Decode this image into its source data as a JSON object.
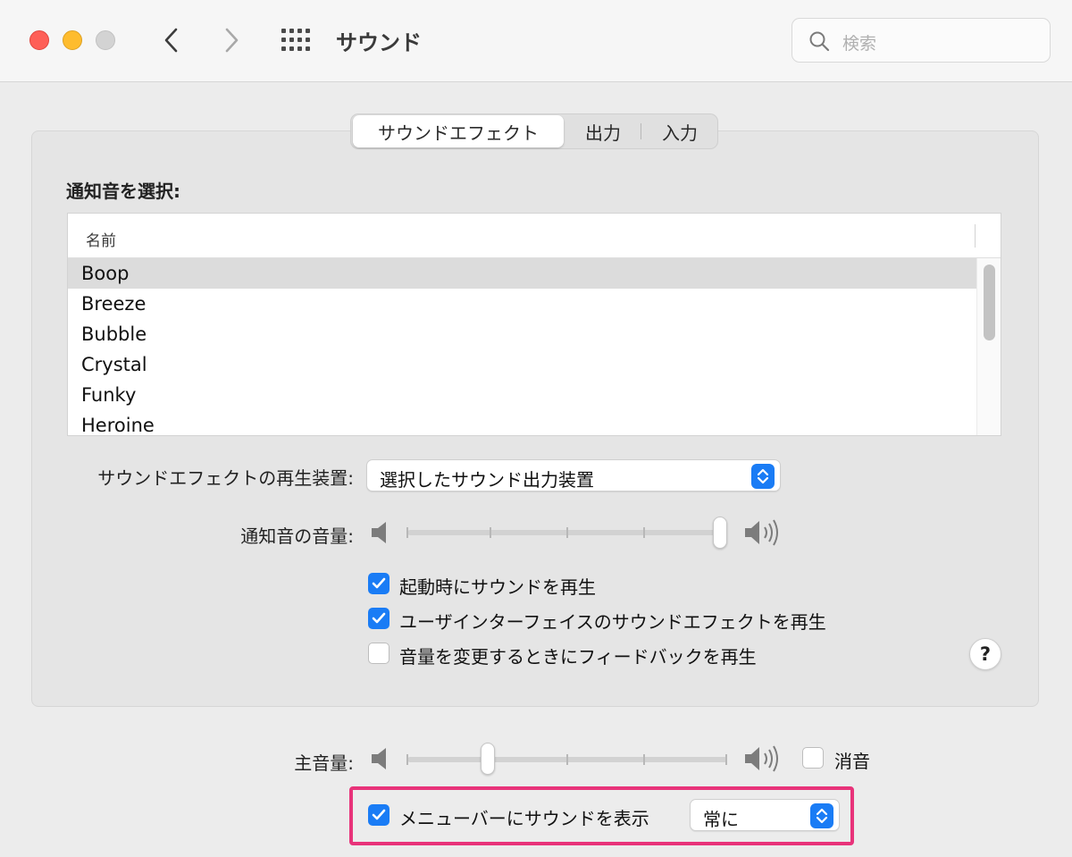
{
  "window": {
    "title": "サウンド",
    "search_placeholder": "検索"
  },
  "tabs": [
    {
      "label": "サウンドエフェクト",
      "selected": true
    },
    {
      "label": "出力",
      "selected": false
    },
    {
      "label": "入力",
      "selected": false
    }
  ],
  "alerts": {
    "section_label": "通知音を選択:",
    "column_header": "名前",
    "sounds": [
      "Boop",
      "Breeze",
      "Bubble",
      "Crystal",
      "Funky",
      "Heroine"
    ],
    "selected": "Boop"
  },
  "playback": {
    "label": "サウンドエフェクトの再生装置:",
    "value": "選択したサウンド出力装置"
  },
  "alert_volume": {
    "label": "通知音の音量:",
    "level": 1.0
  },
  "options": [
    {
      "label": "起動時にサウンドを再生",
      "checked": true
    },
    {
      "label": "ユーザインターフェイスのサウンドエフェクトを再生",
      "checked": true
    },
    {
      "label": "音量を変更するときにフィードバックを再生",
      "checked": false
    }
  ],
  "help_label": "?",
  "master_volume": {
    "label": "主音量:",
    "level": 0.25,
    "mute_label": "消音",
    "muted": false
  },
  "menubar": {
    "label": "メニューバーにサウンドを表示",
    "checked": true,
    "value": "常に"
  },
  "colors": {
    "accent": "#1a7cf5",
    "highlight_border": "#e8337a"
  }
}
